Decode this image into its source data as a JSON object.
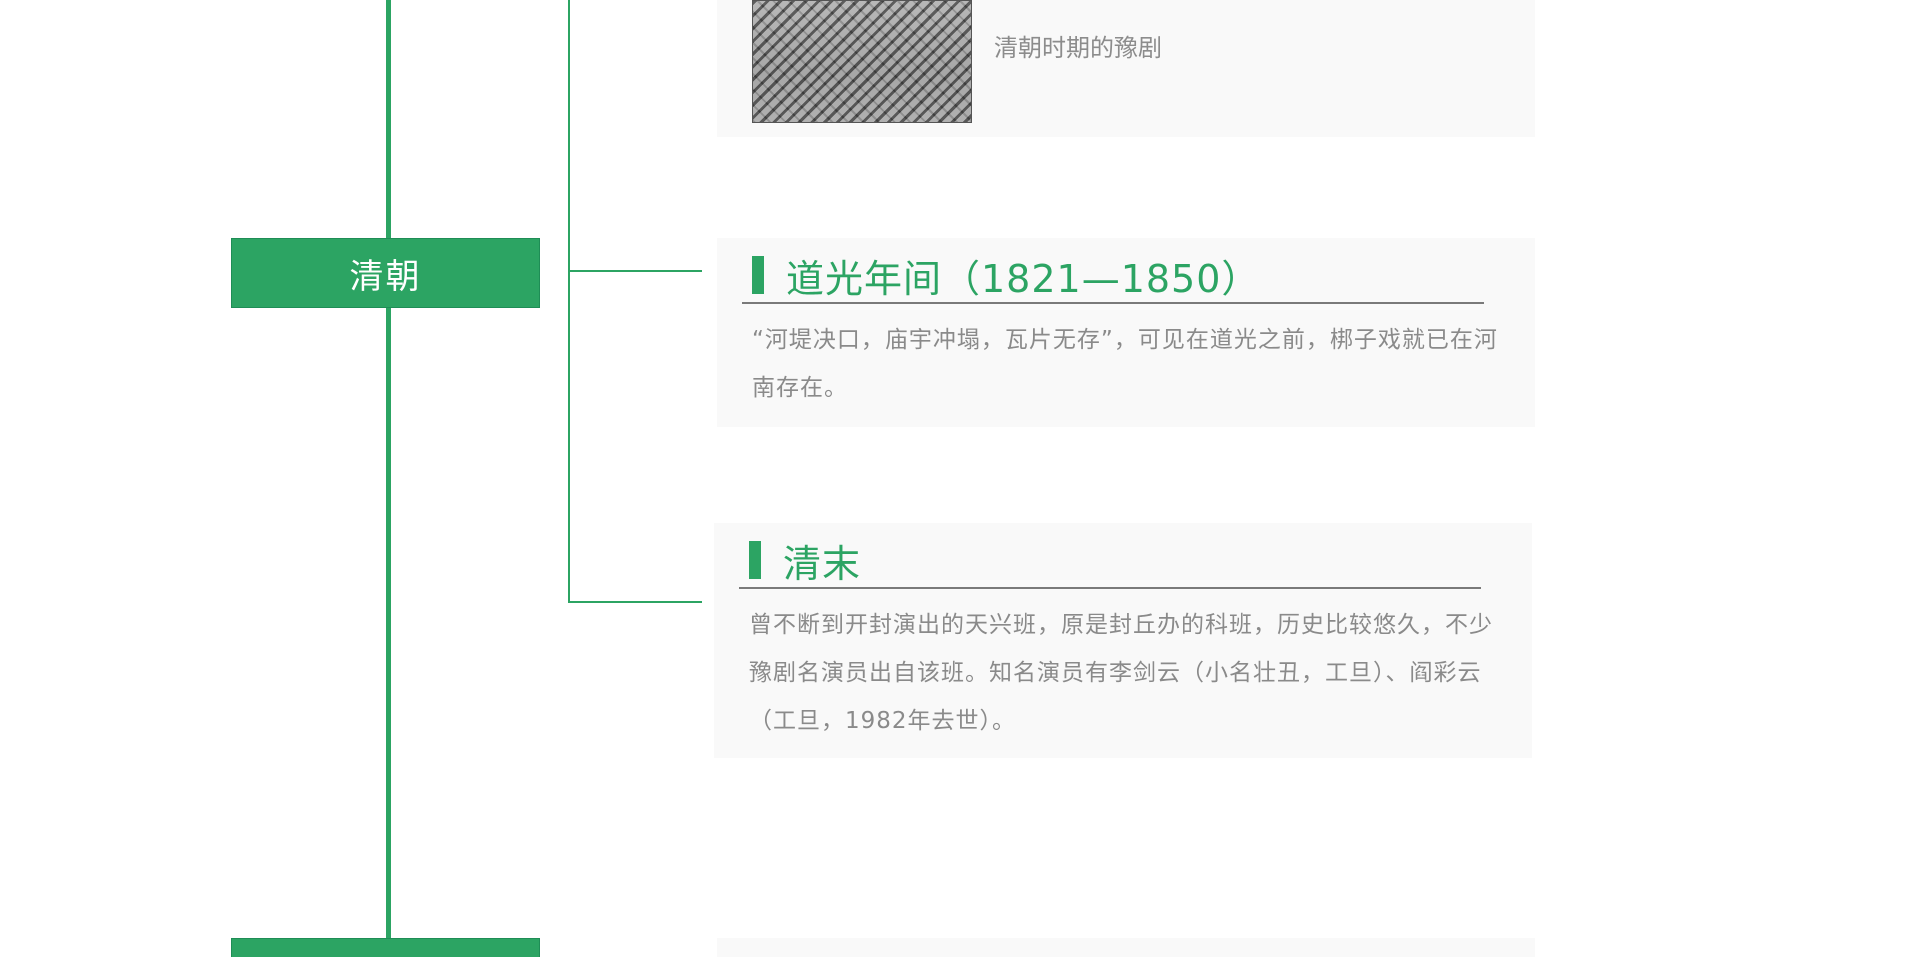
{
  "theme": {
    "accent": "#2ca463",
    "card_bg": "#f9f9f9",
    "text_muted": "#8a8a8a"
  },
  "timeline": {
    "eras": [
      {
        "label": "清朝"
      },
      {
        "label": ""
      }
    ]
  },
  "cards": {
    "painting_card": {
      "image_icon": "qing-painting-image",
      "caption": "清朝时期的豫剧"
    },
    "daoguang": {
      "title": "道光年间（1821—1850）",
      "body": "“河堤决口，庙宇冲塌，瓦片无存”，可见在道光之前，梆子戏就已在河南存在。"
    },
    "qingmo": {
      "title": "清末",
      "body": "曾不断到开封演出的天兴班，原是封丘办的科班，历史比较悠久，不少豫剧名演员出自该班。知名演员有李剑云（小名壮丑，工旦）、阎彩云（工旦，1982年去世）。"
    }
  }
}
